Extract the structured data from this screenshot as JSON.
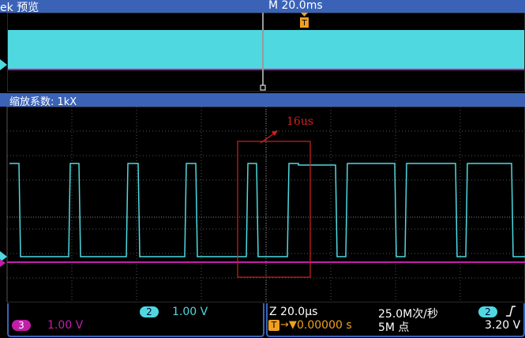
{
  "header": {
    "brand_fragment": "ek 预览",
    "timebase": "M 20.0ms",
    "trigger_marker": "T"
  },
  "zoom": {
    "label": "缩放系数: 1kX",
    "annotation": "16us"
  },
  "status": {
    "ch2_number": "2",
    "ch2_scale": "1.00 V",
    "ch3_number": "3",
    "ch3_scale": "1.00 V",
    "zoom_time": "Z 20.0µs",
    "trig_position_icon": "T",
    "trig_position_arrow": "→▼",
    "trig_position": "0.00000 s",
    "sample_rate": "25.0M次/秒",
    "record_length": "5M 点",
    "trig_channel": "2",
    "trig_slope_icon": "rising-edge-icon",
    "trig_level": "3.20 V"
  },
  "colors": {
    "ch2": "#4fd8e0",
    "ch3": "#c21fa8",
    "trigger": "#f0a020",
    "annotation": "#d02020",
    "bar": "#3a63b8"
  }
}
